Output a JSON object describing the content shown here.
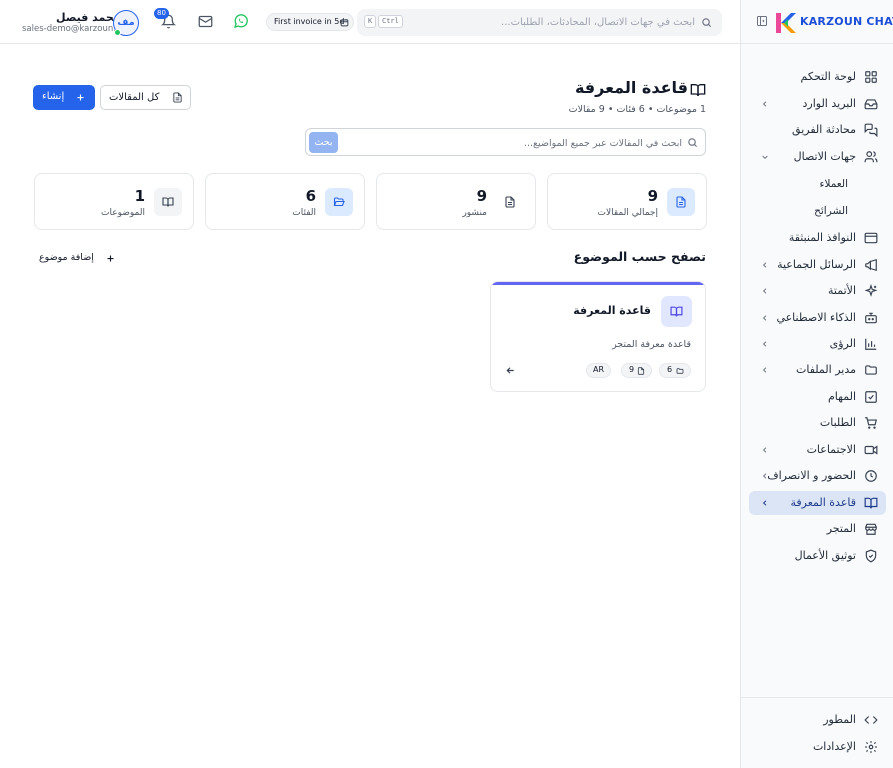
{
  "sidebar": {
    "brand": "KARZOUN CHAT",
    "items": [
      {
        "label": "لوحة التحكم",
        "icon": "dashboard-icon"
      },
      {
        "label": "البريد الوارد",
        "icon": "inbox-icon"
      },
      {
        "label": "محادثة الفريق",
        "icon": "team-chat-icon"
      },
      {
        "label": "جهات الاتصال",
        "icon": "contacts-icon"
      },
      {
        "label": "العملاء"
      },
      {
        "label": "الشرائح"
      },
      {
        "label": "النوافذ المنبثقة",
        "icon": "popup-icon"
      },
      {
        "label": "الرسائل الجماعية",
        "icon": "megaphone-icon"
      },
      {
        "label": "الأتمتة",
        "icon": "sparkles-icon"
      },
      {
        "label": "الذكاء الاصطناعي",
        "icon": "bot-icon"
      },
      {
        "label": "الرؤى",
        "icon": "chart-icon"
      },
      {
        "label": "مدير الملفات",
        "icon": "folder-icon"
      },
      {
        "label": "المهام",
        "icon": "task-icon"
      },
      {
        "label": "الطلبات",
        "icon": "cart-icon"
      },
      {
        "label": "الاجتماعات",
        "icon": "video-icon"
      },
      {
        "label": "الحضور و الانصراف",
        "icon": "clock-icon"
      },
      {
        "label": "قاعدة المعرفة",
        "icon": "book-icon"
      },
      {
        "label": "المتجر",
        "icon": "store-icon"
      },
      {
        "label": "توثيق الأعمال",
        "icon": "shield-check-icon"
      }
    ],
    "footer": [
      {
        "label": "المطور",
        "icon": "code-icon"
      },
      {
        "label": "الإعدادات",
        "icon": "gear-icon"
      }
    ]
  },
  "header": {
    "search_placeholder": "ابحث في جهات الاتصال، المحادثات، الطلبات...",
    "shortcut_k": "K",
    "shortcut_ctrl": "Ctrl",
    "invoice_text": "First invoice in 5d",
    "notifications_count": "80",
    "user_name": "محمد فيصل",
    "user_email": "sales-demo@karzoun...",
    "user_initials": "مف"
  },
  "page": {
    "title": "قاعدة المعرفة",
    "subtitle": "1 موضوعات • 6 فئات • 9 مقالات",
    "create_label": "إنشاء",
    "all_articles_label": "كل المقالات",
    "search_placeholder": "ابحث في المقالات عبر جميع المواضيع...",
    "search_button": "بحث"
  },
  "stats": [
    {
      "value": "9",
      "label": "إجمالي المقالات",
      "icon": "document-icon"
    },
    {
      "value": "9",
      "label": "منشور",
      "icon": "file-text-icon"
    },
    {
      "value": "6",
      "label": "الفئات",
      "icon": "folder-open-icon"
    },
    {
      "value": "1",
      "label": "الموضوعات",
      "icon": "book-icon"
    }
  ],
  "browse": {
    "title": "تصفح حسب الموضوع",
    "add_topic_label": "إضافة موضوع"
  },
  "topics": [
    {
      "title": "قاعدة المعرفة",
      "description": "قاعدة معرفة المتجر",
      "folders": "6",
      "articles": "9",
      "language": "AR"
    }
  ],
  "colors": {
    "primary": "#2563eb",
    "topic_accent": "#6366f1",
    "active_nav_bg": "#dbe5f5",
    "whatsapp": "#22c55e"
  }
}
